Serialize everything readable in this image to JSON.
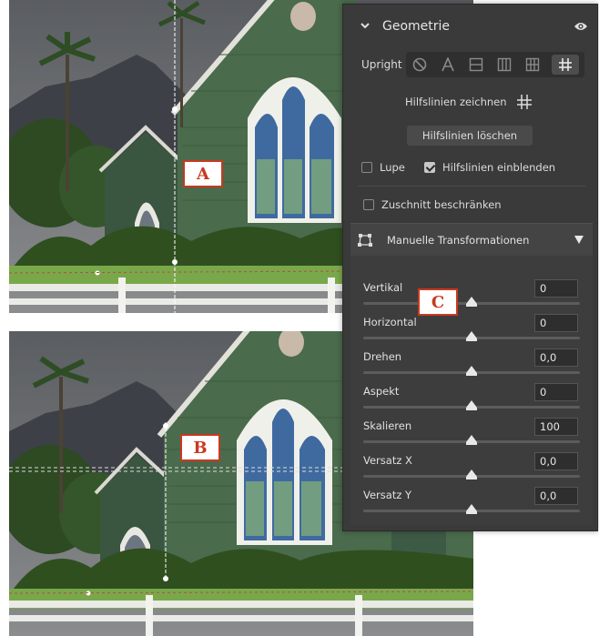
{
  "badges": {
    "a": "A",
    "b": "B",
    "c": "C"
  },
  "panel": {
    "title": "Geometrie",
    "upright": {
      "label": "Upright",
      "buttons": [
        {
          "name": "upright-off-button",
          "icon": "circle-slash-icon",
          "active": false
        },
        {
          "name": "upright-auto-button",
          "icon": "letter-a-icon",
          "active": false
        },
        {
          "name": "upright-level-button",
          "icon": "level-icon",
          "active": false
        },
        {
          "name": "upright-vertical-button",
          "icon": "vertical-icon",
          "active": false
        },
        {
          "name": "upright-full-button",
          "icon": "grid-icon",
          "active": false
        },
        {
          "name": "upright-guided-button",
          "icon": "guided-crosshair-icon",
          "active": true
        }
      ]
    },
    "draw_guides": "Hilfslinien zeichnen",
    "clear_guides": "Hilfslinien löschen",
    "loupe": {
      "label": "Lupe",
      "checked": false
    },
    "show_guides": {
      "label": "Hilfslinien einblenden",
      "checked": true
    },
    "constrain_crop": {
      "label": "Zuschnitt beschränken",
      "checked": false
    },
    "manual": {
      "title": "Manuelle Transformationen",
      "sliders": [
        {
          "label": "Vertikal",
          "value": "0",
          "position": 0.5
        },
        {
          "label": "Horizontal",
          "value": "0",
          "position": 0.5
        },
        {
          "label": "Drehen",
          "value": "0,0",
          "position": 0.5
        },
        {
          "label": "Aspekt",
          "value": "0",
          "position": 0.5
        },
        {
          "label": "Skalieren",
          "value": "100",
          "position": 0.5
        },
        {
          "label": "Versatz X",
          "value": "0,0",
          "position": 0.5
        },
        {
          "label": "Versatz Y",
          "value": "0,0",
          "position": 0.5
        }
      ]
    }
  },
  "colors": {
    "accent": "#c8391f",
    "panel_bg": "#3a3a3a"
  }
}
